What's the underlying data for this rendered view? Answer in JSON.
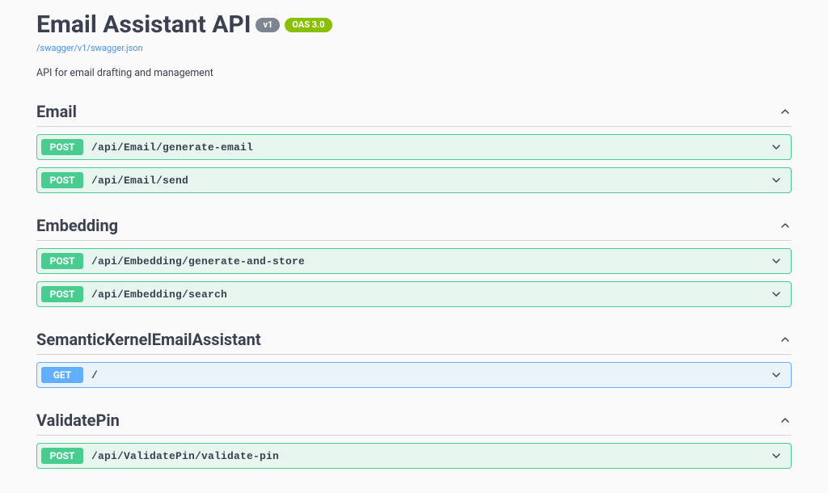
{
  "header": {
    "title": "Email Assistant API",
    "version_badge": "v1",
    "oas_badge": "OAS 3.0",
    "spec_link": "/swagger/v1/swagger.json",
    "description": "API for email drafting and management"
  },
  "tags": [
    {
      "name": "Email",
      "endpoints": [
        {
          "method": "POST",
          "method_class": "post",
          "path": "/api/Email/generate-email"
        },
        {
          "method": "POST",
          "method_class": "post",
          "path": "/api/Email/send"
        }
      ]
    },
    {
      "name": "Embedding",
      "endpoints": [
        {
          "method": "POST",
          "method_class": "post",
          "path": "/api/Embedding/generate-and-store"
        },
        {
          "method": "POST",
          "method_class": "post",
          "path": "/api/Embedding/search"
        }
      ]
    },
    {
      "name": "SemanticKernelEmailAssistant",
      "endpoints": [
        {
          "method": "GET",
          "method_class": "get",
          "path": "/"
        }
      ]
    },
    {
      "name": "ValidatePin",
      "endpoints": [
        {
          "method": "POST",
          "method_class": "post",
          "path": "/api/ValidatePin/validate-pin"
        }
      ]
    }
  ]
}
